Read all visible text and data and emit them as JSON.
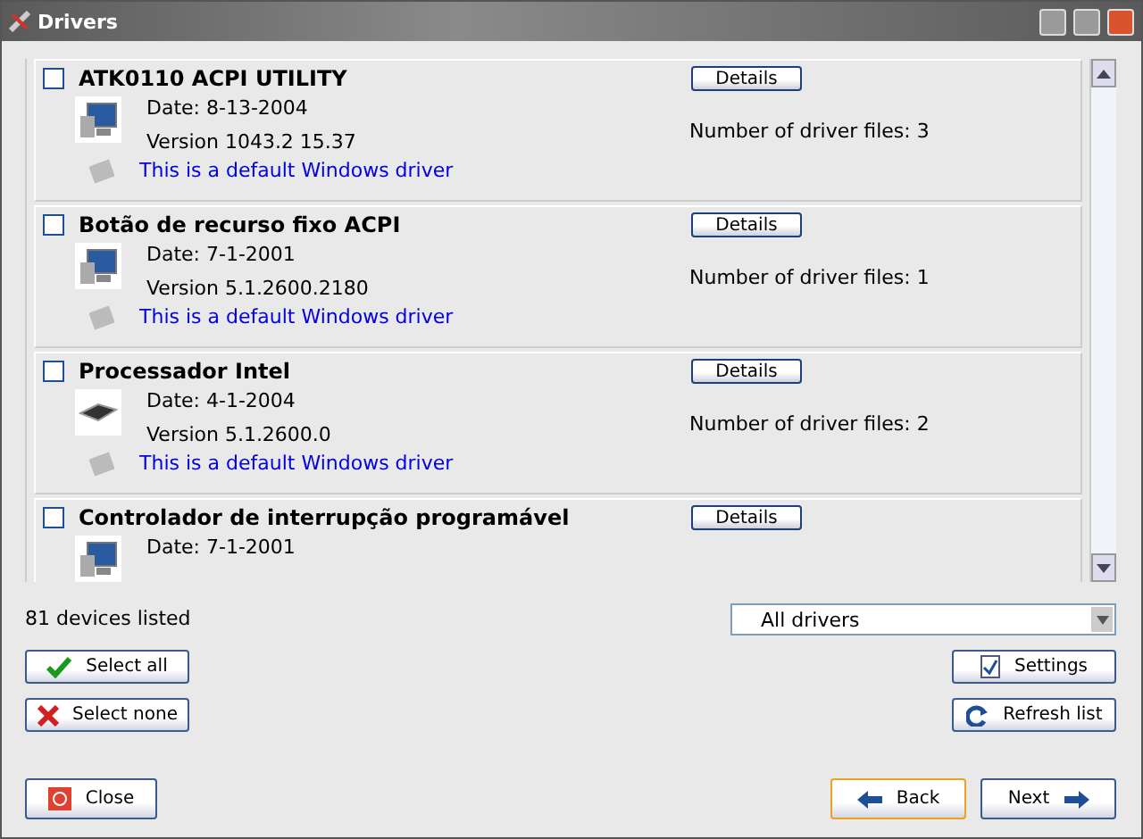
{
  "window": {
    "title": "Drivers"
  },
  "drivers": [
    {
      "name": "ATK0110 ACPI UTILITY",
      "checked": false,
      "kind": "monitor",
      "date": "Date: 8-13-2004",
      "version": "Version  1043.2 15.37",
      "note": "This is a default Windows driver",
      "details": "Details",
      "files": "Number of driver files: 3"
    },
    {
      "name": "Botão de recurso fixo ACPI",
      "checked": false,
      "kind": "monitor",
      "date": "Date: 7-1-2001",
      "version": "Version  5.1.2600.2180",
      "note": "This is a default Windows driver",
      "details": "Details",
      "files": "Number of driver files: 1"
    },
    {
      "name": "Processador Intel",
      "checked": false,
      "kind": "chip",
      "date": "Date: 4-1-2004",
      "version": "Version  5.1.2600.0",
      "note": "This is a default Windows driver",
      "details": "Details",
      "files": "Number of driver files: 2"
    },
    {
      "name": "Controlador de interrupção programável",
      "checked": false,
      "kind": "monitor",
      "date": "Date: 7-1-2001",
      "details": "Details"
    }
  ],
  "count": "81 devices listed",
  "filter": {
    "value": "All drivers"
  },
  "buttons": {
    "select_all": "Select all",
    "select_none": "Select none",
    "settings": "Settings",
    "refresh": "Refresh list",
    "close": "Close",
    "back": "Back",
    "next": "Next"
  }
}
